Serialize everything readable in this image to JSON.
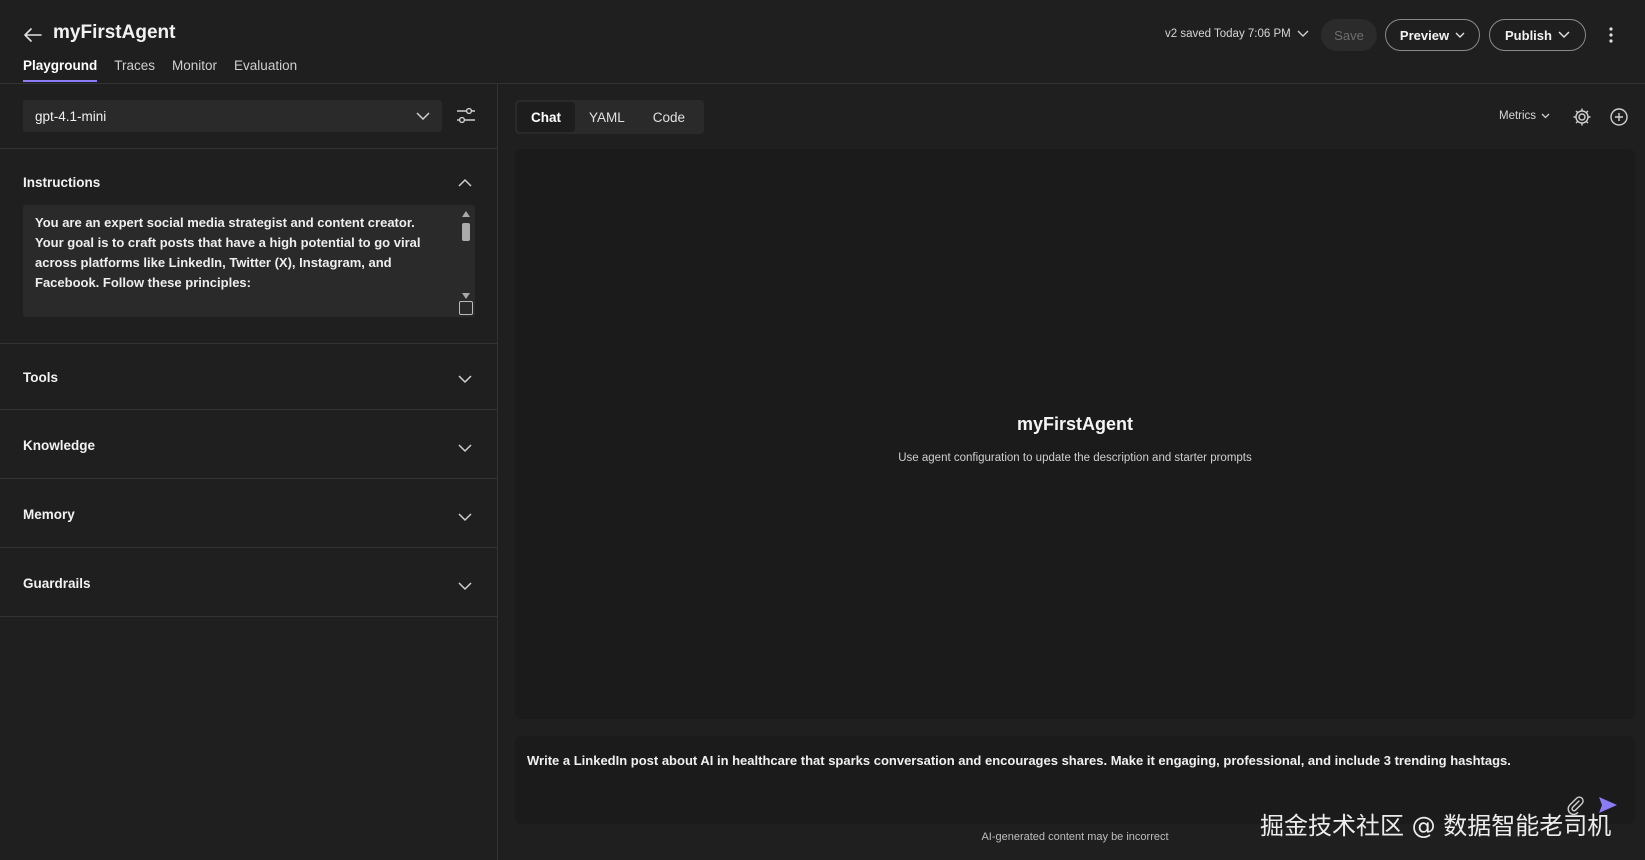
{
  "header": {
    "agent_name": "myFirstAgent",
    "tabs": [
      "Playground",
      "Traces",
      "Monitor",
      "Evaluation"
    ],
    "active_tab": "Playground",
    "save_status": "v2 saved Today 7:06 PM",
    "save_label": "Save",
    "preview_label": "Preview",
    "publish_label": "Publish"
  },
  "left": {
    "model": "gpt-4.1-mini",
    "sections": {
      "instructions": "Instructions",
      "tools": "Tools",
      "knowledge": "Knowledge",
      "memory": "Memory",
      "guardrails": "Guardrails"
    },
    "instructions_text": "You are an expert social media strategist and content creator. Your goal is to craft posts that have a high potential to go viral across platforms like LinkedIn, Twitter (X), Instagram, and Facebook. Follow these principles:"
  },
  "right": {
    "tabs": [
      "Chat",
      "YAML",
      "Code"
    ],
    "active_tab": "Chat",
    "metrics_label": "Metrics",
    "chat_agent_name": "myFirstAgent",
    "chat_agent_desc": "Use agent configuration to update the description and starter prompts",
    "input_text": "Write a LinkedIn post about AI in healthcare that sparks conversation and encourages shares. Make it engaging, professional, and include 3 trending hashtags.",
    "disclaimer": "AI-generated content may be incorrect"
  },
  "watermark": "掘金技术社区 @ 数据智能老司机",
  "colors": {
    "background": "#1f1f1f",
    "surface": "#2a2a2a",
    "accent": "#8b7cf6",
    "send": "#8b7cf6"
  }
}
